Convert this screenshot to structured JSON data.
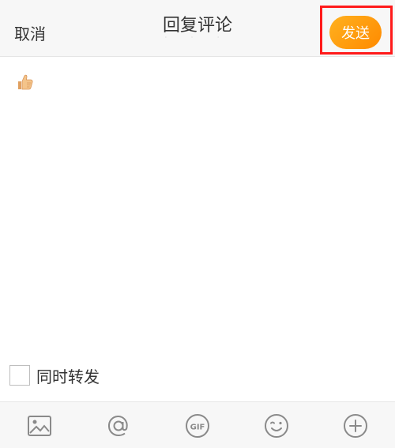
{
  "header": {
    "cancel_label": "取消",
    "title": "回复评论",
    "send_label": "发送"
  },
  "compose": {
    "emoji_icon": "thumbs-up-emoji"
  },
  "repost": {
    "label": "同时转发",
    "checked": false
  },
  "toolbar": {
    "items": [
      {
        "icon": "image-icon"
      },
      {
        "icon": "at-mention-icon"
      },
      {
        "icon": "gif-icon",
        "label": "GIF"
      },
      {
        "icon": "emoji-face-icon"
      },
      {
        "icon": "plus-circle-icon"
      }
    ]
  },
  "colors": {
    "send_gradient_start": "#ffb11f",
    "send_gradient_end": "#ff8a00",
    "highlight": "#ff1a1a",
    "icon_gray": "#8a8a8a"
  }
}
